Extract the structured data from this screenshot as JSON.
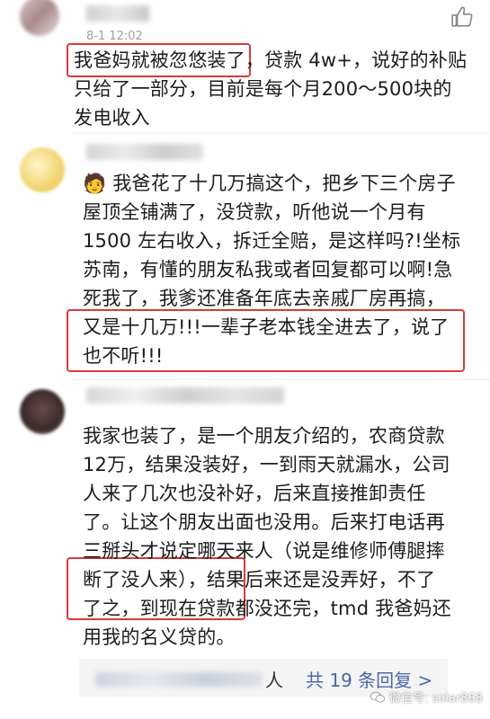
{
  "comments": [
    {
      "time": "8-1 12:02",
      "lines": [
        "我爸妈就被忽悠装了，贷款 4w+，说好的补贴",
        "只给了一部分，目前是每个月200～500块的",
        "发电收入"
      ]
    },
    {
      "lines": [
        "🧑 我爸花了十几万搞这个，把乡下三个房子",
        "屋顶全铺满了，没贷款，听他说一个月有",
        "1500 左右收入，拆迁全赔，是这样吗?!坐标",
        "苏南，有懂的朋友私我或者回复都可以啊!急",
        "死我了，我爹还准备年底去亲戚厂房再搞，",
        "又是十几万!!!一辈子老本钱全进去了，说了",
        "也不听!!!"
      ]
    },
    {
      "lines": [
        "我家也装了，是一个朋友介绍的，农商贷款",
        "12万，结果没装好，一到雨天就漏水，公司",
        "人来了几次也没补好，后来直接推卸责任",
        "了。让这个朋友出面也没用。后来打电话再",
        "三掰头才说定哪天来人（说是维修师傅腿摔",
        "断了没人来），结果后来还是没弄好，不了",
        "了之，到现在贷款都没还完，tmd 我爸妈还",
        "用我的名义贷的。"
      ]
    }
  ],
  "reply": {
    "suffix": "人",
    "link": "共 19 条回复 >"
  },
  "watermark": "微信号: solar868",
  "colors": {
    "highlight": "#d83a3a",
    "link": "#4a67a8"
  },
  "icons": {
    "like": "thumbs-up-icon",
    "watermark": "wechat-icon"
  }
}
